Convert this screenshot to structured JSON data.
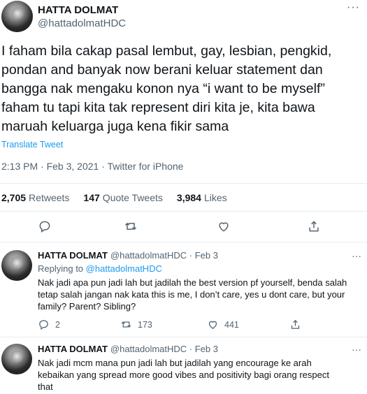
{
  "main_tweet": {
    "display_name": "HATTA DOLMAT",
    "handle": "@hattadolmatHDC",
    "more_icon": "ellipsis-icon",
    "text_lines": [
      "I faham bila cakap pasal lembut, gay, lesbian, pengkid,",
      "pondan and banyak now berani keluar statement dan",
      "bangga  nak mengaku konon nya “i want to be myself”",
      "faham tu tapi kita tak represent diri kita je, kita bawa",
      "maruah keluarga juga kena fikir sama"
    ],
    "translate_label": "Translate Tweet",
    "meta": "2:13 PM · Feb 3, 2021 · Twitter for iPhone",
    "stats": {
      "retweets_count": "2,705",
      "retweets_label": "Retweets",
      "quotes_count": "147",
      "quotes_label": "Quote Tweets",
      "likes_count": "3,984",
      "likes_label": "Likes"
    }
  },
  "replies": [
    {
      "display_name": "HATTA DOLMAT",
      "handle_time": "@hattadolmatHDC · Feb 3",
      "replying_prefix": "Replying to",
      "replying_to": "@hattadolmatHDC",
      "text_lines": [
        "Nak jadi apa pun jadi lah but jadilah the best version pf yourself, benda salah",
        "tetap salah jangan nak kata this is me, I don’t care, yes u dont care, but your",
        "family? Parent? Sibling?"
      ],
      "reply_count": "2",
      "retweet_count": "173",
      "like_count": "441"
    },
    {
      "display_name": "HATTA DOLMAT",
      "handle_time": "@hattadolmatHDC · Feb 3",
      "text_lines": [
        "Nak jadi mcm mana pun jadi lah but jadilah yang encourage ke arah",
        "kebaikan yang spread more good vibes and positivity bagi orang respect",
        "that"
      ]
    }
  ],
  "colors": {
    "accent": "#1d9bf0",
    "secondary_text": "#536471",
    "primary_text": "#0f1419",
    "divider": "#e6ecf0"
  }
}
